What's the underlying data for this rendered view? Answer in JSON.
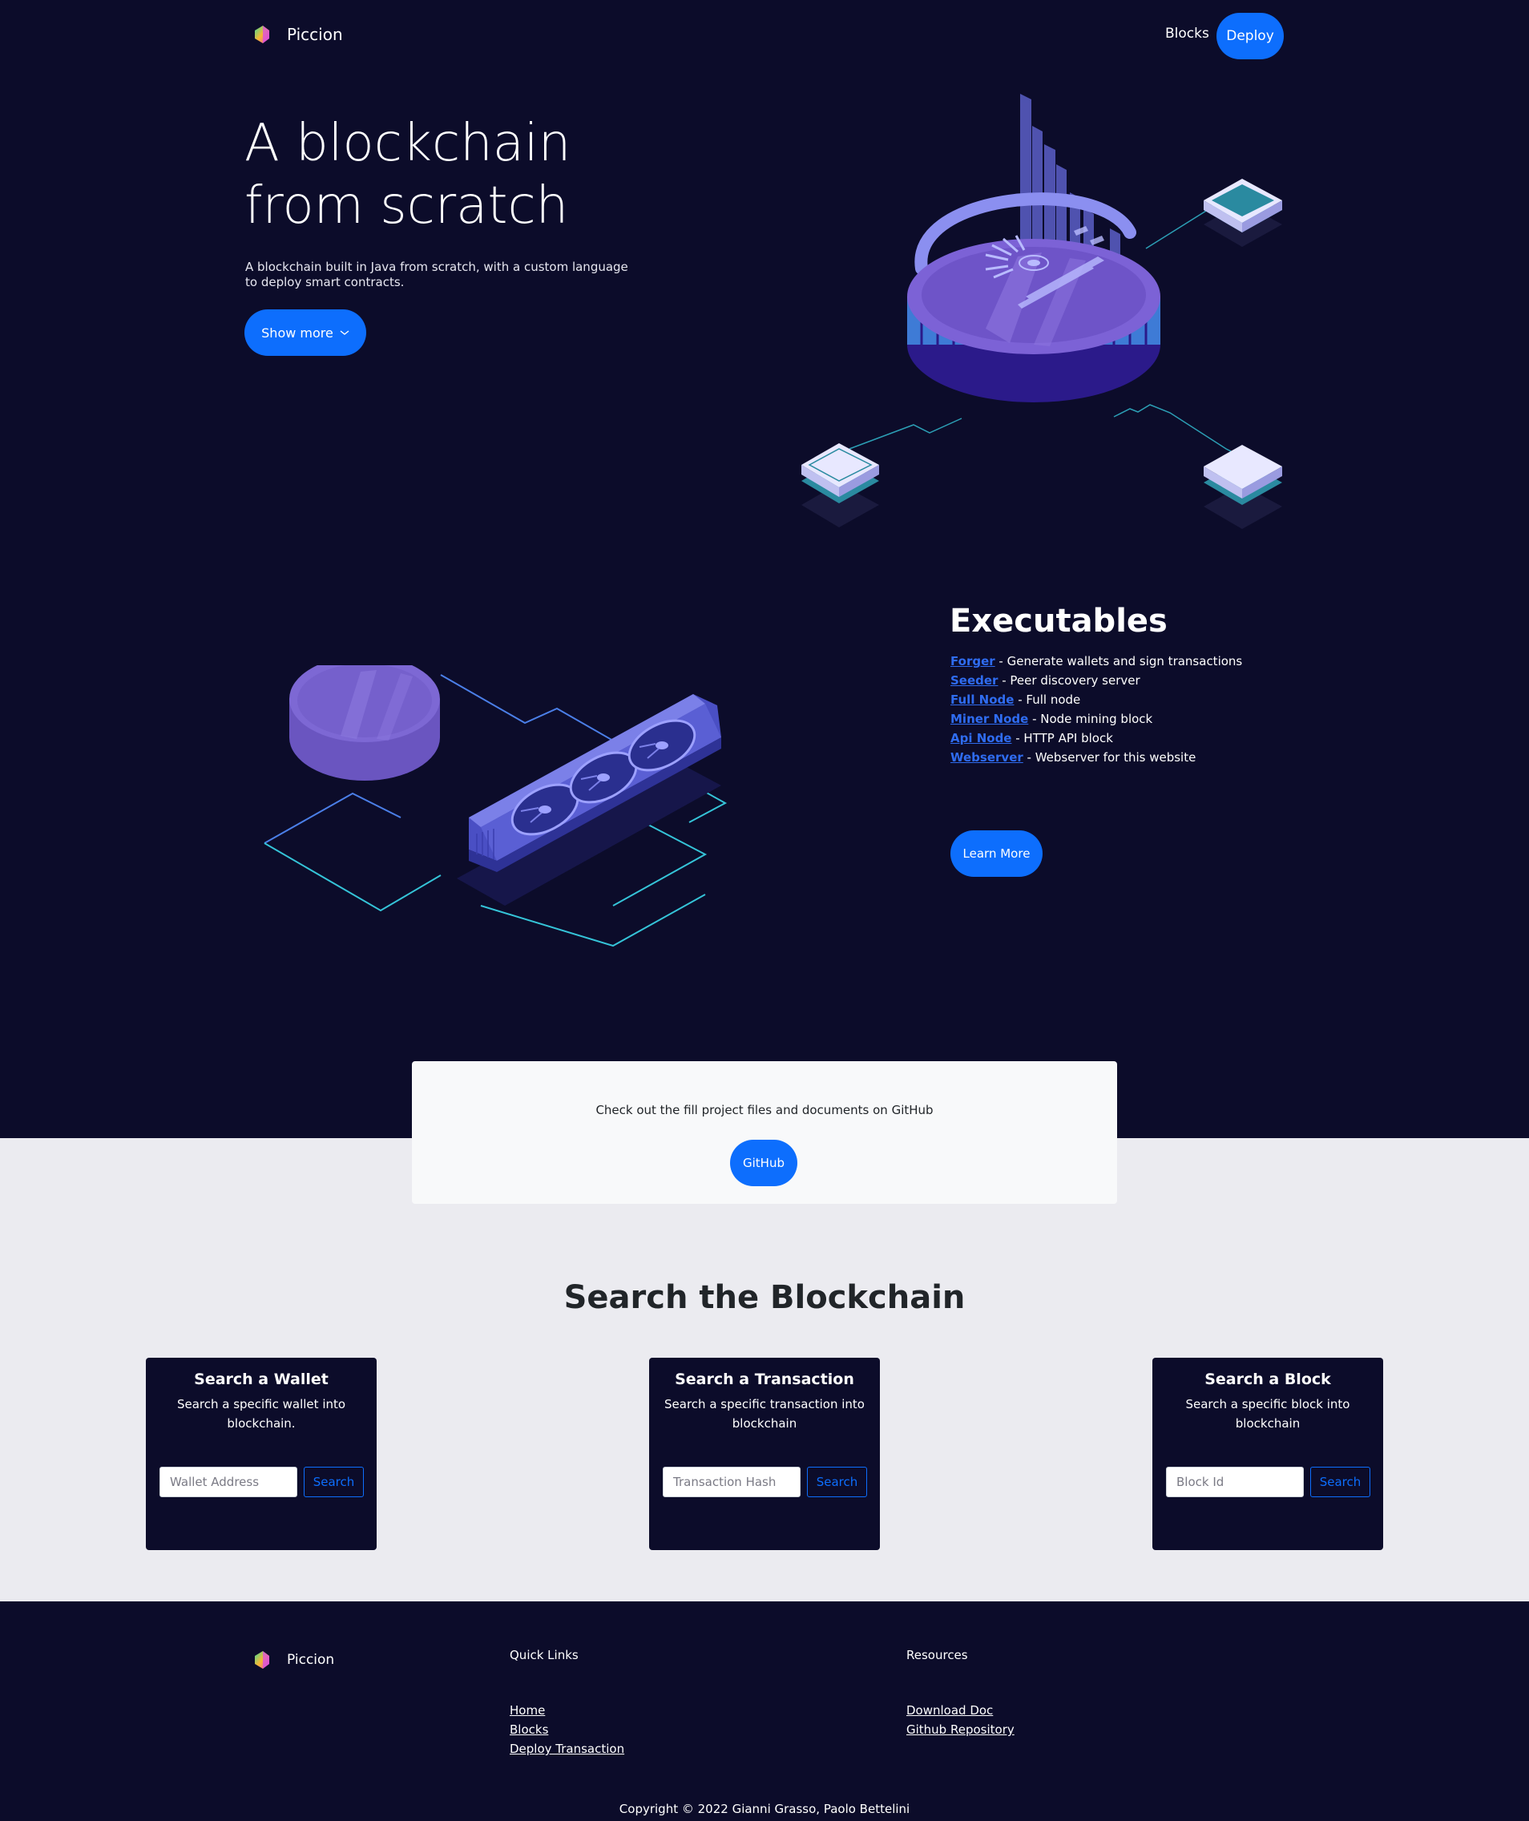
{
  "header": {
    "brand": "Piccion",
    "nav": {
      "blocks": "Blocks",
      "deploy": "Deploy"
    }
  },
  "hero": {
    "title_line1": "A blockchain",
    "title_line2": "from scratch",
    "subtitle": "A blockchain built in Java from scratch, with a custom language to deploy smart contracts.",
    "show_more": "Show more",
    "show_more_icon": "chevron-down-icon"
  },
  "executables": {
    "title": "Executables",
    "items": [
      {
        "name": "Forger",
        "desc": " - Generate wallets and sign transactions"
      },
      {
        "name": "Seeder",
        "desc": " - Peer discovery server"
      },
      {
        "name": "Full Node",
        "desc": " - Full node"
      },
      {
        "name": "Miner Node",
        "desc": " - Node mining block"
      },
      {
        "name": "Api Node",
        "desc": " - HTTP API block"
      },
      {
        "name": "Webserver",
        "desc": " - Webserver for this website"
      }
    ],
    "learn_more": "Learn More"
  },
  "github_card": {
    "text": "Check out the fill project files and documents on GitHub",
    "button": "GitHub"
  },
  "search": {
    "title": "Search the Blockchain",
    "cards": [
      {
        "title": "Search a Wallet",
        "desc": "Search a specific wallet into blockchain.",
        "placeholder": "Wallet Address",
        "button": "Search"
      },
      {
        "title": "Search a Transaction",
        "desc": "Search a specific transaction into blockchain",
        "placeholder": "Transaction Hash",
        "button": "Search"
      },
      {
        "title": "Search a Block",
        "desc": "Search a specific block into blockchain",
        "placeholder": "Block Id",
        "button": "Search"
      }
    ]
  },
  "footer": {
    "brand": "Piccion",
    "quick_links": {
      "title": "Quick Links",
      "links": [
        "Home",
        "Blocks",
        "Deploy Transaction"
      ]
    },
    "resources": {
      "title": "Resources",
      "links": [
        "Download Doc",
        "Github Repository"
      ]
    },
    "copyright": "Copyright © 2022 Gianni Grasso, Paolo Bettelini"
  },
  "colors": {
    "background_dark": "#0c0c2a",
    "background_light": "#ebebf0",
    "accent": "#0d6efd",
    "link": "#2f6cf0"
  }
}
